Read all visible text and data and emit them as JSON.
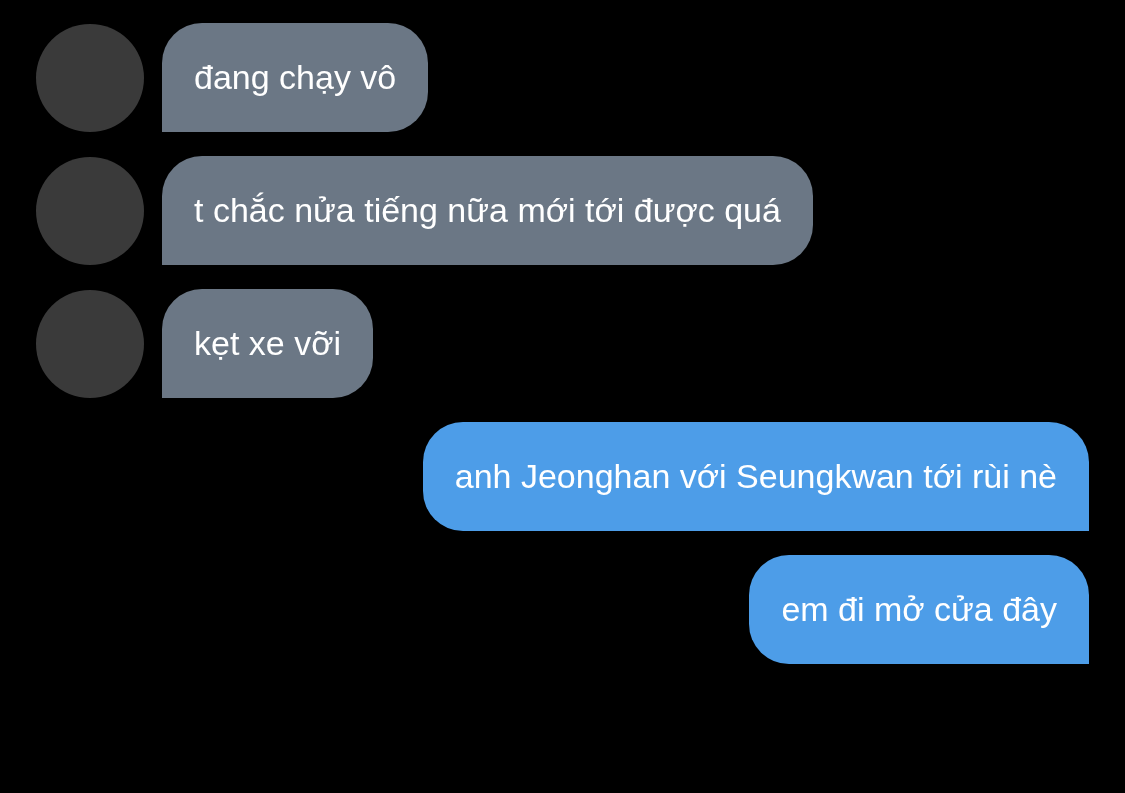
{
  "messages": [
    {
      "kind": "incoming",
      "text": "đang chạy vô"
    },
    {
      "kind": "incoming",
      "text": "t chắc nửa tiếng nữa mới tới được quá"
    },
    {
      "kind": "incoming",
      "text": "kẹt xe vỡi"
    },
    {
      "kind": "outgoing",
      "text": "anh Jeonghan với Seungkwan tới rùi nè"
    },
    {
      "kind": "outgoing",
      "text": "em đi mở cửa đây"
    }
  ]
}
